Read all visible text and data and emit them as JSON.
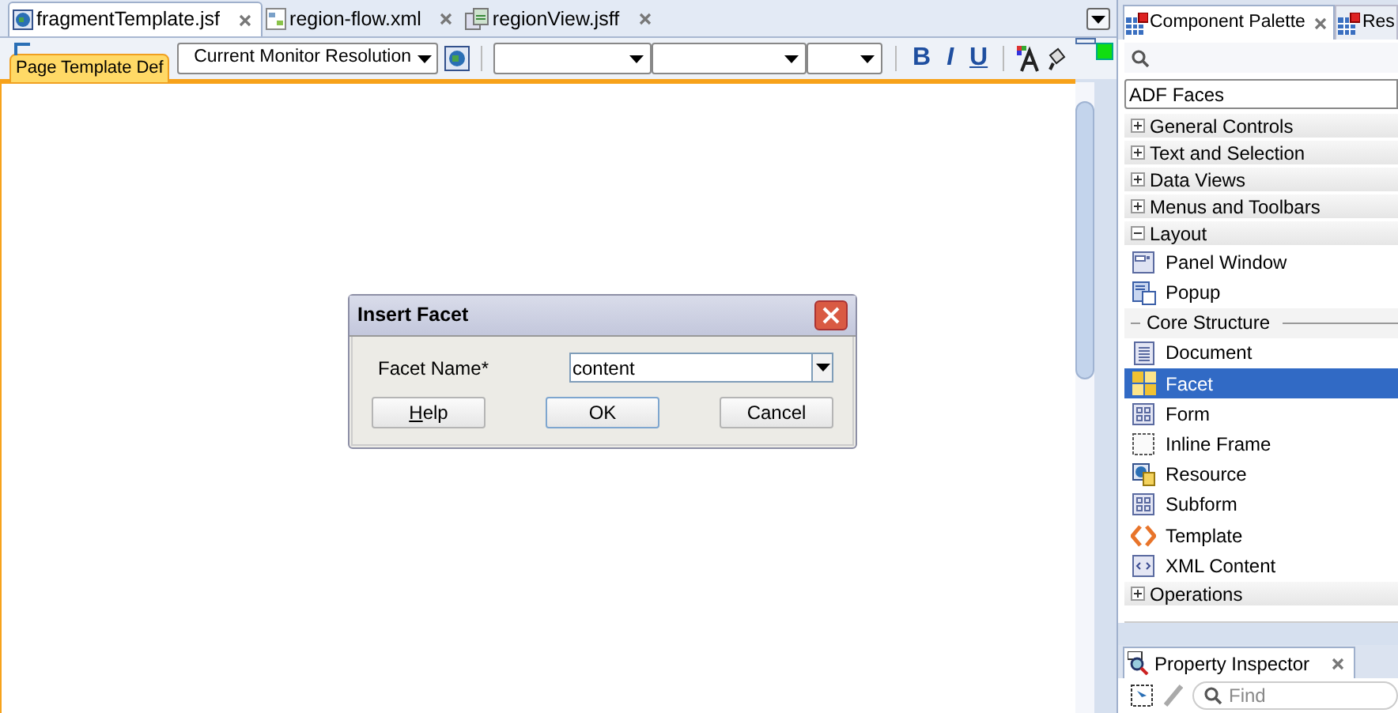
{
  "editor_tabs": [
    {
      "label": "fragmentTemplate.jsf",
      "selected": true,
      "kind": "page"
    },
    {
      "label": "region-flow.xml",
      "selected": false,
      "kind": "flow"
    },
    {
      "label": "regionView.jsff",
      "selected": false,
      "kind": "fragment"
    }
  ],
  "toolbar": {
    "resolution": "Current Monitor Resolution",
    "bold": "B",
    "italic": "I",
    "underline": "U"
  },
  "template_tag": "Page Template Def",
  "dialog": {
    "title": "Insert Facet",
    "field_label": "Facet Name*",
    "field_value": "content",
    "buttons": [
      {
        "label": "Help",
        "kind": "help"
      },
      {
        "label": "OK",
        "kind": "default"
      },
      {
        "label": "Cancel",
        "kind": "normal"
      }
    ]
  },
  "palette": {
    "tabs": [
      {
        "label": "Component Palette",
        "selected": true
      },
      {
        "label": "Res",
        "selected": false
      }
    ],
    "library": "ADF Faces",
    "sections": [
      {
        "label": "General Controls",
        "expanded": false
      },
      {
        "label": "Text and Selection",
        "expanded": false
      },
      {
        "label": "Data Views",
        "expanded": false
      },
      {
        "label": "Menus and Toolbars",
        "expanded": false
      },
      {
        "label": "Layout",
        "expanded": true,
        "items": [
          {
            "kind": "window",
            "label": "Panel Window",
            "selected": false
          },
          {
            "kind": "popup",
            "label": "Popup",
            "selected": false
          },
          {
            "kind": "subheading",
            "label": "Core Structure"
          },
          {
            "kind": "document",
            "label": "Document",
            "selected": false
          },
          {
            "kind": "facet",
            "label": "Facet",
            "selected": true
          },
          {
            "kind": "form",
            "label": "Form",
            "selected": false
          },
          {
            "kind": "frame",
            "label": "Inline Frame",
            "selected": false
          },
          {
            "kind": "resource",
            "label": "Resource",
            "selected": false
          },
          {
            "kind": "form",
            "label": "Subform",
            "selected": false
          },
          {
            "kind": "template",
            "label": "Template",
            "selected": false
          },
          {
            "kind": "xml",
            "label": "XML Content",
            "selected": false
          }
        ]
      },
      {
        "label": "Operations",
        "expanded": false
      }
    ]
  },
  "inspector": {
    "tab": "Property Inspector",
    "search_placeholder": "Find"
  }
}
